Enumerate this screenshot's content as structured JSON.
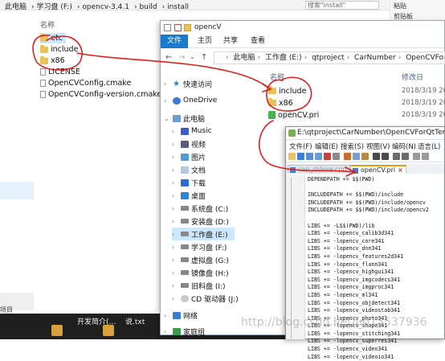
{
  "background_window": {
    "breadcrumb": [
      "此电脑",
      "学习盘 (F:)",
      "opencv-3.4.1",
      "build",
      "install"
    ],
    "search_placeholder": "搜索\"install\"",
    "ribbon_labels": [
      "粘贴",
      "剪贴板"
    ],
    "column_name": "名称",
    "files": [
      {
        "name": "etc",
        "type": "folder"
      },
      {
        "name": "include",
        "type": "folder"
      },
      {
        "name": "x86",
        "type": "folder"
      },
      {
        "name": "LICENSE",
        "type": "file"
      },
      {
        "name": "OpenCVConfig.cmake",
        "type": "file"
      },
      {
        "name": "OpenCVConfig-version.cmake",
        "type": "file"
      }
    ],
    "status": "项目"
  },
  "taskbar": {
    "items": [
      "开发简介(…",
      "说.txt"
    ]
  },
  "foreground_window": {
    "title": "opencV",
    "ribbon_tabs": [
      "文件",
      "主页",
      "共享",
      "查看"
    ],
    "address": [
      "此电脑",
      "工作盘 (E:)",
      "qtproject",
      "CarNumber",
      "OpenCVForQtTe"
    ],
    "nav_items": [
      {
        "label": "快速访问",
        "icon": "star-icon"
      },
      {
        "label": "OneDrive",
        "icon": "cloud-icon"
      },
      {
        "label": "此电脑",
        "icon": "computer-icon"
      },
      {
        "label": "Music",
        "icon": "music-icon"
      },
      {
        "label": "视频",
        "icon": "video-icon"
      },
      {
        "label": "图片",
        "icon": "picture-icon"
      },
      {
        "label": "文档",
        "icon": "document-icon"
      },
      {
        "label": "下载",
        "icon": "download-icon"
      },
      {
        "label": "桌面",
        "icon": "desktop-icon"
      },
      {
        "label": "系统盘 (C:)",
        "icon": "drive-icon"
      },
      {
        "label": "安装盘 (D:)",
        "icon": "drive-icon"
      },
      {
        "label": "工作盘 (E:)",
        "icon": "drive-icon"
      },
      {
        "label": "学习盘 (F:)",
        "icon": "drive-icon"
      },
      {
        "label": "虚拟盘 (G:)",
        "icon": "drive-icon"
      },
      {
        "label": "镜像盘 (H:)",
        "icon": "drive-icon"
      },
      {
        "label": "旧料盘 (I:)",
        "icon": "drive-icon"
      },
      {
        "label": "CD 驱动器 (J:)",
        "icon": "cd-icon"
      },
      {
        "label": "网络",
        "icon": "network-icon"
      },
      {
        "label": "家庭组",
        "icon": "homegroup-icon"
      }
    ],
    "column_name": "名称",
    "column_date": "修改日",
    "files": [
      {
        "name": "include",
        "date": "2018/3/19 20"
      },
      {
        "name": "x86",
        "date": "2018/3/19 20"
      },
      {
        "name": "openCV.pri",
        "date": "2018/3/19 20"
      }
    ]
  },
  "notepad": {
    "title": "E:\\qtproject\\CarNumber\\OpenCVForQtTempla",
    "menu": [
      "文件(F)",
      "编辑(E)",
      "搜索(S)",
      "视图(V)",
      "编码(N)",
      "语言(L)"
    ],
    "tabs": [
      {
        "label": "cap_dshow.cpp",
        "active": false
      },
      {
        "label": "openCV.pri",
        "active": true
      }
    ],
    "close_glyph": "×",
    "code_lines": [
      "DEPENDPATH += $$(PWD)",
      "",
      "INCLUDEPATH += $$(PWD)/include",
      "INCLUDEPATH += $$(PWD)/include/opencv",
      "INCLUDEPATH += $$(PWD)/include/opencv2",
      "",
      "LIBS += -L$$(PWD)/lib",
      "LIBS += -lopencv_calib3d341",
      "LIBS += -lopencv_core341",
      "LIBS += -lopencv_dnn341",
      "LIBS += -lopencv_features2d341",
      "LIBS += -lopencv_flann341",
      "LIBS += -lopencv_highgui341",
      "LIBS += -lopencv_imgcodecs341",
      "LIBS += -lopencv_imgproc341",
      "LIBS += -lopencv_ml341",
      "LIBS += -lopencv_objdetect341",
      "LIBS += -lopencv_videostab341",
      "LIBS += -lopencv_photo341",
      "LIBS += -lopencv_shape341",
      "LIBS += -lopencv_stitching341",
      "LIBS += -lopencv_superres341",
      "LIBS += -lopencv_video341",
      "LIBS += -lopencv_videoio341"
    ]
  },
  "watermark": "http://blog.csdn.net/u013537936",
  "colors": {
    "accent": "#1979ca",
    "annotation": "#e02020",
    "folder": "#e8c255",
    "selection": "#cce8ff"
  }
}
